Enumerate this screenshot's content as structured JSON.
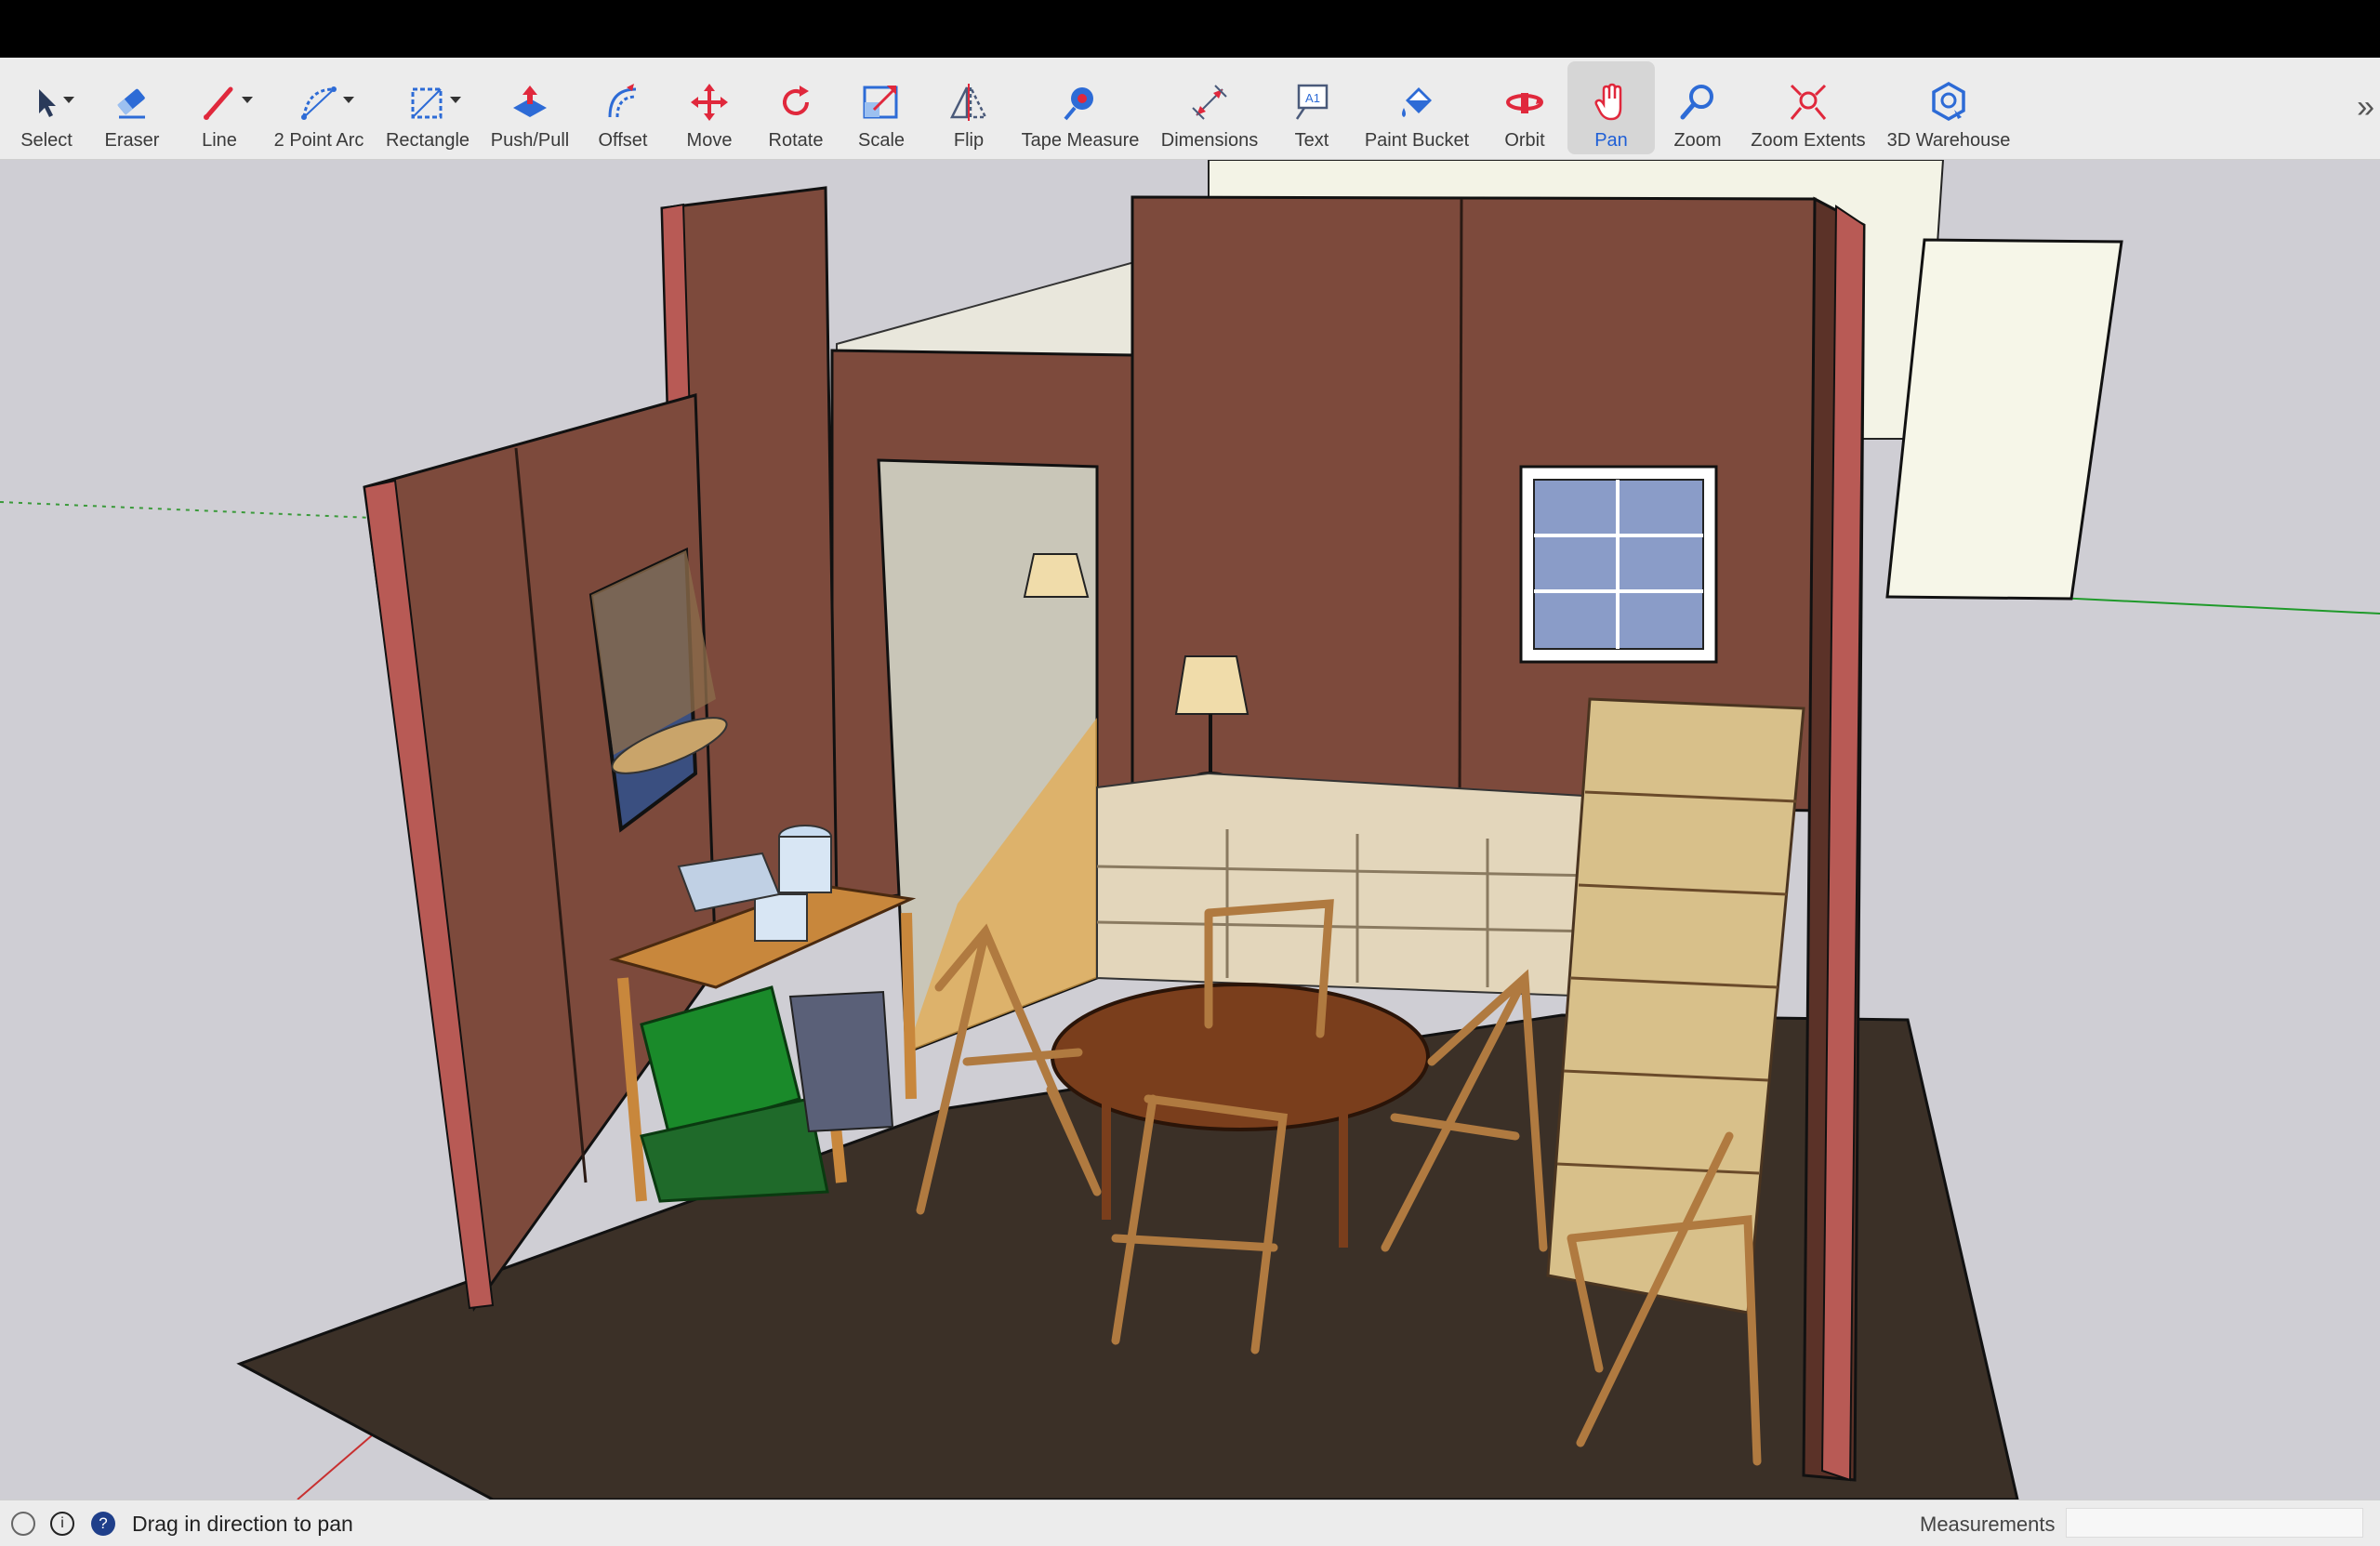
{
  "toolbar": {
    "tools": [
      {
        "label": "Select",
        "icon": "select-arrow-icon"
      },
      {
        "label": "Eraser",
        "icon": "eraser-icon"
      },
      {
        "label": "Line",
        "icon": "pencil-line-icon"
      },
      {
        "label": "2 Point Arc",
        "icon": "arc-icon"
      },
      {
        "label": "Rectangle",
        "icon": "rectangle-icon"
      },
      {
        "label": "Push/Pull",
        "icon": "push-pull-icon"
      },
      {
        "label": "Offset",
        "icon": "offset-icon"
      },
      {
        "label": "Move",
        "icon": "move-icon"
      },
      {
        "label": "Rotate",
        "icon": "rotate-icon"
      },
      {
        "label": "Scale",
        "icon": "scale-icon"
      },
      {
        "label": "Flip",
        "icon": "flip-icon"
      },
      {
        "label": "Tape Measure",
        "icon": "tape-measure-icon"
      },
      {
        "label": "Dimensions",
        "icon": "dimensions-icon"
      },
      {
        "label": "Text",
        "icon": "text-icon"
      },
      {
        "label": "Paint Bucket",
        "icon": "paint-bucket-icon"
      },
      {
        "label": "Orbit",
        "icon": "orbit-icon"
      },
      {
        "label": "Pan",
        "icon": "pan-hand-icon",
        "active": true
      },
      {
        "label": "Zoom",
        "icon": "zoom-magnifier-icon"
      },
      {
        "label": "Zoom Extents",
        "icon": "zoom-extents-icon"
      },
      {
        "label": "3D Warehouse",
        "icon": "3d-warehouse-icon"
      }
    ],
    "overflow_icon": "chevron-double-right-icon"
  },
  "status": {
    "message": "Drag in direction to pan",
    "measurements_label": "Measurements",
    "measurements_value": ""
  },
  "colors": {
    "accent": "#1f5fd6",
    "icon_red": "#e0283c",
    "icon_blue": "#2d6bd6",
    "wall": "#7d4a3c",
    "wall_edge": "#b85a55",
    "floor": "#3b3027",
    "viewport": "#cfced4"
  }
}
